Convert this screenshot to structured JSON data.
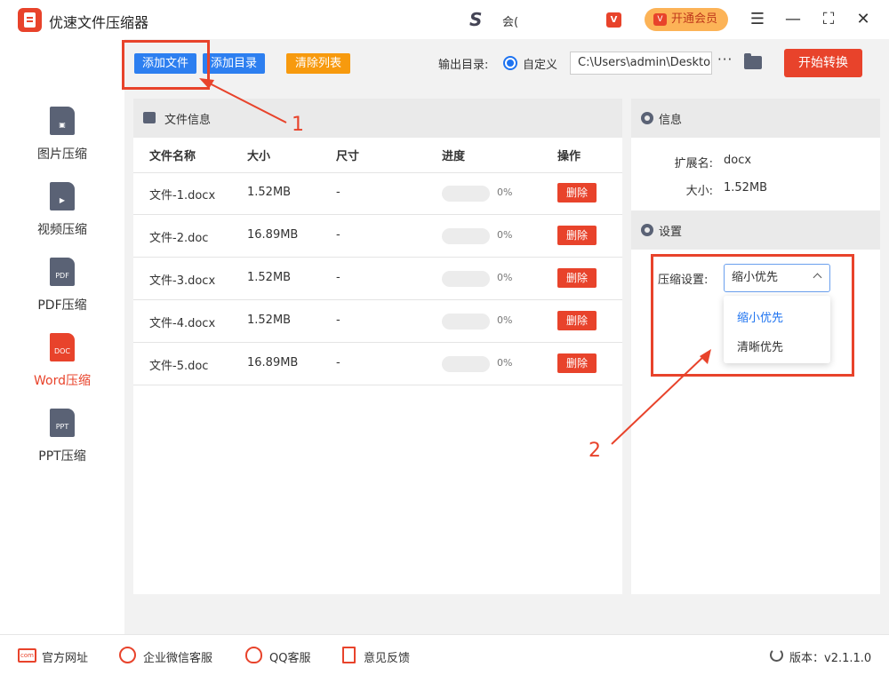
{
  "app": {
    "title": "优速文件压缩器"
  },
  "header": {
    "username": "会(",
    "vip_label": "开通会员",
    "vip_badge": "V"
  },
  "sidebar": {
    "items": [
      {
        "label": "图片压缩",
        "icon": "image-file-icon",
        "badge": ""
      },
      {
        "label": "视频压缩",
        "icon": "video-file-icon",
        "badge": ""
      },
      {
        "label": "PDF压缩",
        "icon": "pdf-file-icon",
        "badge": "PDF"
      },
      {
        "label": "Word压缩",
        "icon": "doc-file-icon",
        "badge": "DOC",
        "active": true
      },
      {
        "label": "PPT压缩",
        "icon": "ppt-file-icon",
        "badge": "PPT"
      }
    ]
  },
  "toolbar": {
    "add_file": "添加文件",
    "add_dir": "添加目录",
    "clear_list": "清除列表",
    "output_label": "输出目录:",
    "radio_custom": "自定义",
    "output_path": "C:\\Users\\admin\\Deskto",
    "more": "···",
    "start": "开始转换"
  },
  "file_panel": {
    "title": "文件信息",
    "columns": [
      "文件名称",
      "大小",
      "尺寸",
      "进度",
      "操作"
    ],
    "rows": [
      {
        "name": "文件-1.docx",
        "size": "1.52MB",
        "dim": "-",
        "progress": "0%",
        "action": "删除"
      },
      {
        "name": "文件-2.doc",
        "size": "16.89MB",
        "dim": "-",
        "progress": "0%",
        "action": "删除"
      },
      {
        "name": "文件-3.docx",
        "size": "1.52MB",
        "dim": "-",
        "progress": "0%",
        "action": "删除"
      },
      {
        "name": "文件-4.docx",
        "size": "1.52MB",
        "dim": "-",
        "progress": "0%",
        "action": "删除"
      },
      {
        "name": "文件-5.doc",
        "size": "16.89MB",
        "dim": "-",
        "progress": "0%",
        "action": "删除"
      }
    ]
  },
  "info_panel": {
    "title": "信息",
    "ext_label": "扩展名:",
    "ext_value": "docx",
    "size_label": "大小:",
    "size_value": "1.52MB"
  },
  "settings_panel": {
    "title": "设置",
    "compress_label": "压缩设置:",
    "selected": "缩小优先",
    "options": [
      "缩小优先",
      "清晰优先"
    ]
  },
  "annotations": {
    "one": "1",
    "two": "2"
  },
  "footer": {
    "links": [
      "官方网址",
      "企业微信客服",
      "QQ客服",
      "意见反馈"
    ],
    "version": "版本：v2.1.1.0"
  },
  "colors": {
    "accent": "#e8432b",
    "blue": "#2d7ff0",
    "orange": "#f79a0e"
  }
}
